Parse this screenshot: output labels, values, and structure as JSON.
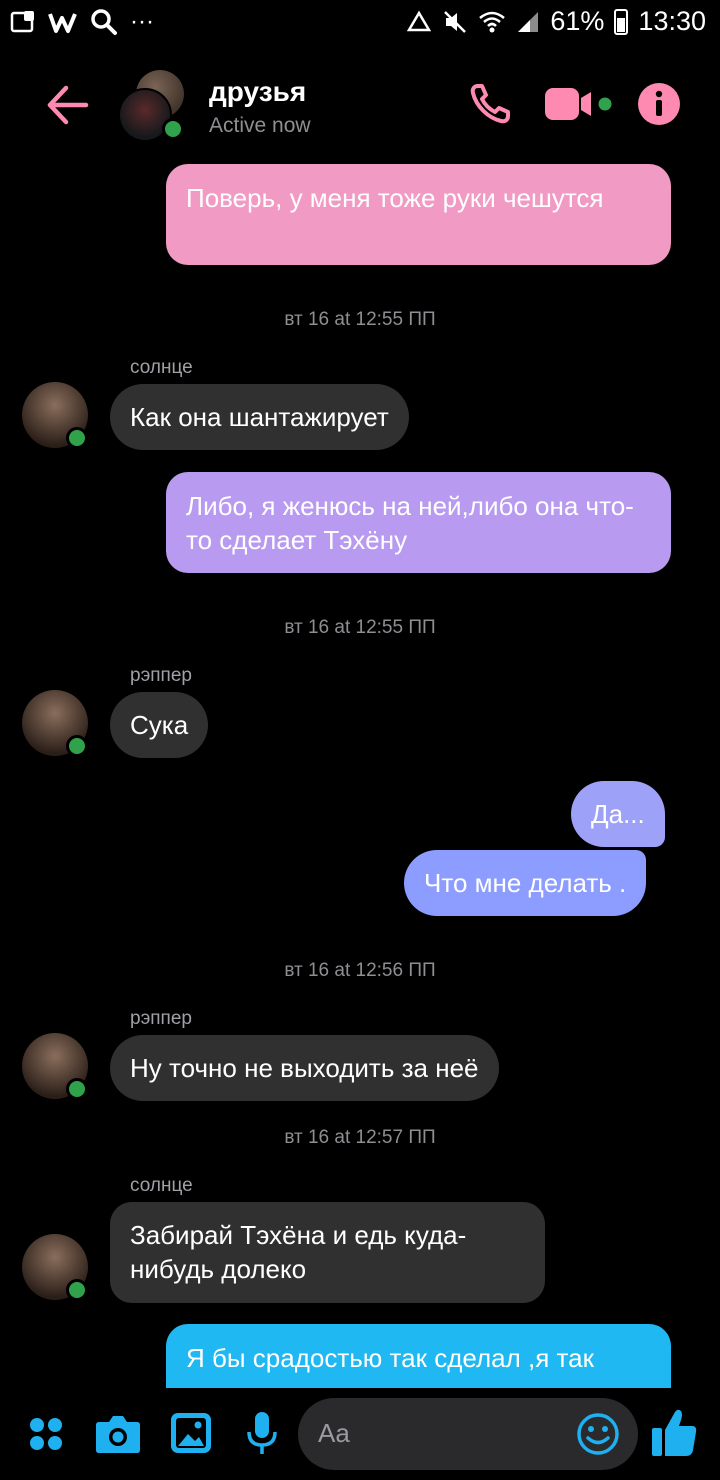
{
  "status_bar": {
    "battery_percent": "61%",
    "time": "13:30"
  },
  "header": {
    "title": "друзья",
    "subtitle": "Active now"
  },
  "messages": {
    "out_1": "Поверь, у меня тоже руки чешутся",
    "ts_1": "вт 16 at 12:55 ПП",
    "sender_1": "солнце",
    "in_1": "Как она шантажирует",
    "out_2": "Либо, я женюсь на ней,либо она что-то сделает Тэхёну",
    "ts_2": "вт 16 at 12:55 ПП",
    "sender_2": "рэппер",
    "in_2": "Сука",
    "out_3": "Да...",
    "out_4": "Что мне делать .",
    "ts_3": "вт 16 at 12:56 ПП",
    "sender_3": "рэппер",
    "in_3": "Ну точно не выходить за неё",
    "ts_4": "вт 16 at 12:57 ПП",
    "sender_4": "солнце",
    "in_4": "Забирай Тэхёна и едь куда-нибудь долеко",
    "out_5": "Я бы срадостью так сделал ,я так"
  },
  "composer": {
    "placeholder": "Aa"
  },
  "colors": {
    "accent_pink": "#ff8ab1",
    "bubble_pink": "#f19ac3",
    "bubble_violet": "#b89af0",
    "bubble_blue": "#8c9cff",
    "bubble_cyan": "#1fb8f2",
    "composer_blue": "#1fb0f0",
    "online_green": "#31a24c"
  },
  "icons": [
    "back-arrow-icon",
    "phone-icon",
    "video-camera-icon",
    "info-icon",
    "apps-grid-icon",
    "camera-icon",
    "gallery-icon",
    "microphone-icon",
    "emoji-icon",
    "thumbs-up-icon"
  ]
}
